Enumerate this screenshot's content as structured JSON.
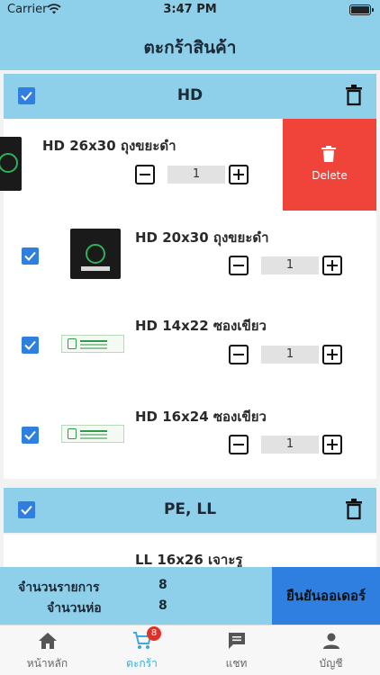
{
  "status_bar": {
    "carrier": "Carrier",
    "time": "3:47 PM"
  },
  "nav": {
    "title": "ตะกร้าสินค้า"
  },
  "shops": [
    {
      "name": "HD",
      "items": [
        {
          "name": "HD 26x30 ถุงขยะดำ",
          "qty": "1",
          "thumb": "black-bag"
        },
        {
          "name": "HD 20x30 ถุงขยะดำ",
          "qty": "1",
          "thumb": "black-bag"
        },
        {
          "name": "HD 14x22 ซองเขียว",
          "qty": "1",
          "thumb": "green-pack"
        },
        {
          "name": "HD 16x24 ซองเขียว",
          "qty": "1",
          "thumb": "green-pack"
        }
      ]
    },
    {
      "name": "PE, LL",
      "items": [
        {
          "name": "LL 16x26 เจาะรู"
        }
      ]
    }
  ],
  "swipe_action": {
    "label": "Delete"
  },
  "summary": {
    "items_label": "จำนวนรายการ",
    "items_value": "8",
    "packs_label": "จำนวนห่อ",
    "packs_value": "8"
  },
  "confirm_button": "ยืนยันออเดอร์",
  "tabs": [
    {
      "label": "หน้าหลัก",
      "icon": "home-icon"
    },
    {
      "label": "ตะกร้า",
      "icon": "cart-icon",
      "badge": "8",
      "active": true
    },
    {
      "label": "แชท",
      "icon": "chat-icon"
    },
    {
      "label": "บัญชี",
      "icon": "account-icon"
    }
  ],
  "colors": {
    "header": "#8ecfea",
    "accent": "#2f7fe0",
    "delete": "#f0443b",
    "active_tab": "#3aa9e0"
  }
}
